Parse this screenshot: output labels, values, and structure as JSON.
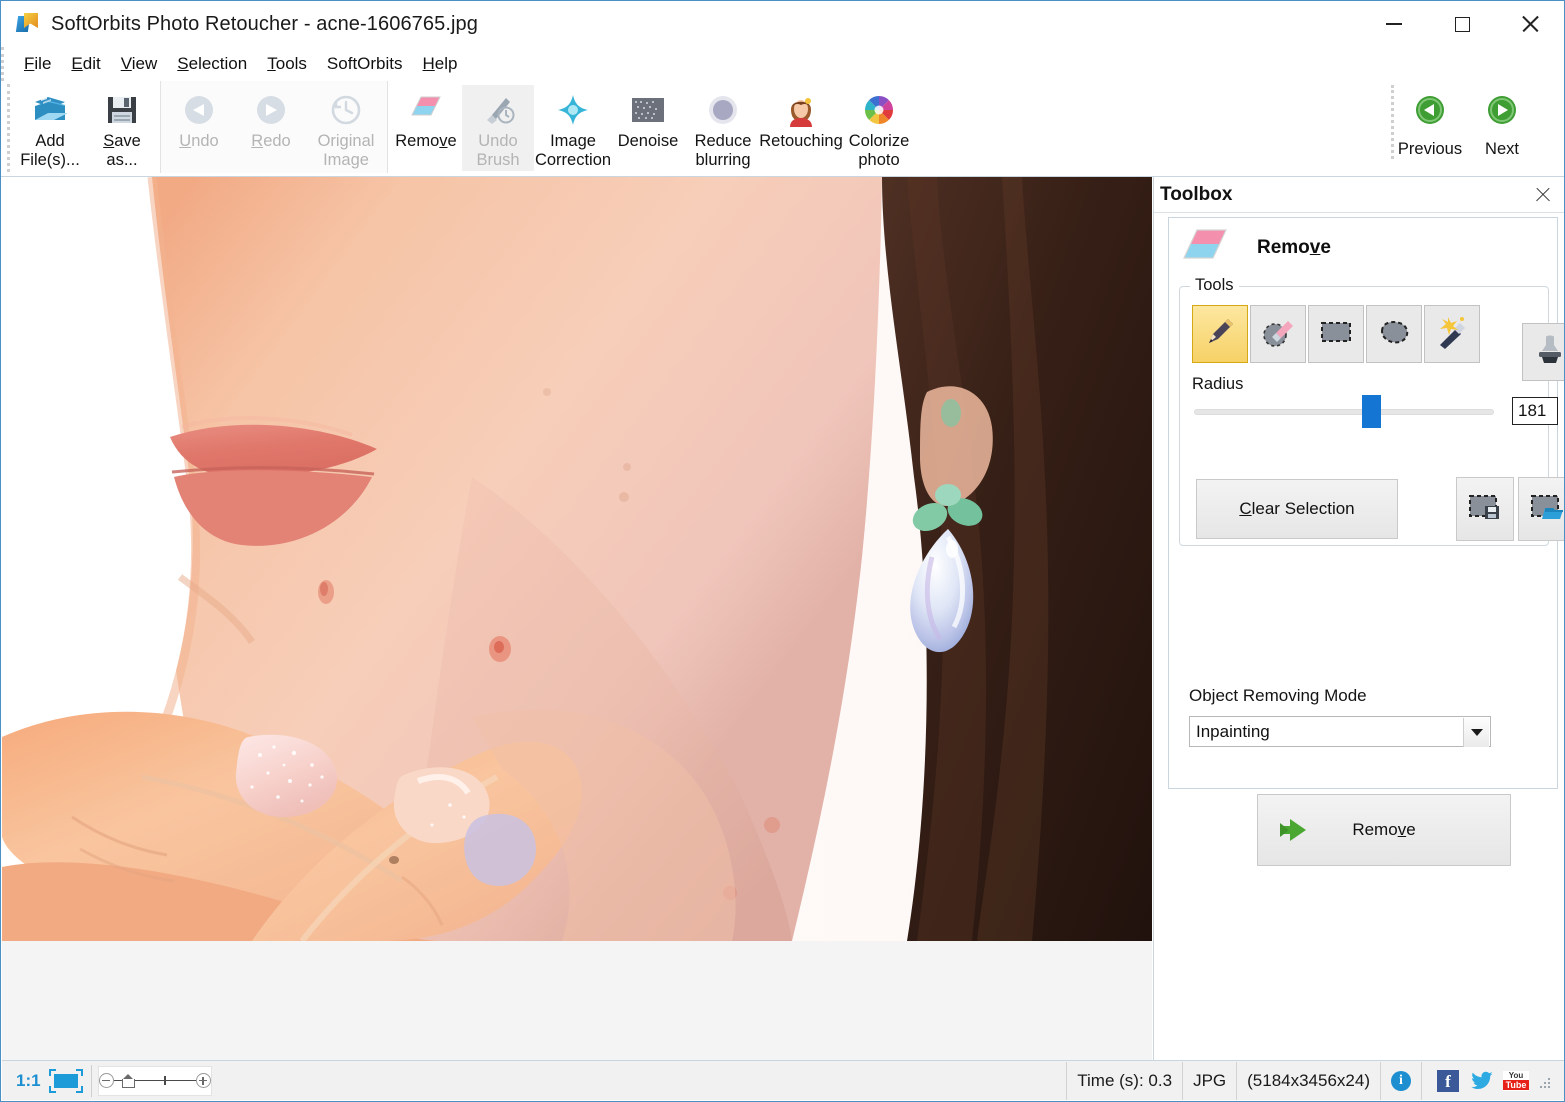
{
  "window": {
    "title": "SoftOrbits Photo Retoucher - acne-1606765.jpg",
    "app_icon": "softorbits-logo-icon",
    "minimize_label": "",
    "maximize_label": "",
    "close_label": ""
  },
  "menubar": {
    "items": [
      {
        "label": "File",
        "accel": "F"
      },
      {
        "label": "Edit",
        "accel": "E"
      },
      {
        "label": "View",
        "accel": "V"
      },
      {
        "label": "Selection",
        "accel": "S"
      },
      {
        "label": "Tools",
        "accel": "T"
      },
      {
        "label": "SoftOrbits",
        "accel": ""
      },
      {
        "label": "Help",
        "accel": "H"
      }
    ]
  },
  "ribbon": {
    "buttons": [
      {
        "label": "Add\nFile(s)...",
        "icon": "add-files-icon",
        "disabled": false,
        "active": false
      },
      {
        "label": "Save\nas...",
        "icon": "save-floppy-icon",
        "disabled": false,
        "active": false
      },
      {
        "label": "Undo",
        "icon": "undo-arrow-icon",
        "disabled": true,
        "active": false
      },
      {
        "label": "Redo",
        "icon": "redo-arrow-icon",
        "disabled": true,
        "active": false
      },
      {
        "label": "Original\nImage",
        "icon": "clock-history-icon",
        "disabled": true,
        "active": false
      },
      {
        "label": "Remove",
        "icon": "eraser-icon",
        "disabled": false,
        "active": false
      },
      {
        "label": "Undo\nBrush",
        "icon": "undo-brush-icon",
        "disabled": true,
        "active": true
      },
      {
        "label": "Image\nCorrection",
        "icon": "sparkle-star-icon",
        "disabled": false,
        "active": false
      },
      {
        "label": "Denoise",
        "icon": "noise-grid-icon",
        "disabled": false,
        "active": false
      },
      {
        "label": "Reduce\nblurring",
        "icon": "blur-circle-icon",
        "disabled": false,
        "active": false
      },
      {
        "label": "Retouching",
        "icon": "portrait-woman-icon",
        "disabled": false,
        "active": false
      },
      {
        "label": "Colorize\nphoto",
        "icon": "color-wheel-icon",
        "disabled": false,
        "active": false
      }
    ],
    "nav": [
      {
        "label": "Previous",
        "icon": "green-left-arrow-icon"
      },
      {
        "label": "Next",
        "icon": "green-right-arrow-icon"
      }
    ],
    "expander_icon": "chevron-down-icon"
  },
  "toolbox": {
    "panel_title": "Toolbox",
    "close_icon": "close-icon",
    "section": {
      "icon": "eraser-icon",
      "title": "Remove",
      "title_accel": "v"
    },
    "tools_group": {
      "legend": "Tools",
      "items": [
        {
          "name": "brush-pencil-tool",
          "icon": "pencil-icon",
          "selected": true
        },
        {
          "name": "eraser-tool",
          "icon": "eraser-selection-icon",
          "selected": false
        },
        {
          "name": "rectangle-select-tool",
          "icon": "rectangle-marquee-icon",
          "selected": false
        },
        {
          "name": "lasso-select-tool",
          "icon": "lasso-icon",
          "selected": false
        },
        {
          "name": "magic-wand-tool",
          "icon": "magic-wand-icon",
          "selected": false
        },
        {
          "name": "clone-stamp-tool",
          "icon": "stamp-icon",
          "selected": false
        }
      ]
    },
    "radius": {
      "label": "Radius",
      "value": "181",
      "slider_percent": 60
    },
    "clear_selection": {
      "label": "Clear Selection",
      "accel": "C"
    },
    "selection_io": [
      {
        "name": "save-selection-button",
        "icon": "save-selection-icon"
      },
      {
        "name": "load-selection-button",
        "icon": "load-selection-icon"
      }
    ],
    "object_removing_mode": {
      "label": "Object Removing Mode",
      "value": "Inpainting",
      "options": [
        "Inpainting"
      ],
      "arrow_icon": "chevron-down-icon"
    },
    "remove_action": {
      "label": "Remove",
      "accel": "v",
      "icon": "green-double-arrow-icon"
    }
  },
  "canvas": {
    "photo_description": "close-up photo of a woman's lower face, chin and cheek with acne spots, her hand with glittery manicured fingernails touching her chin, dangling crystal earring and dark brown hair on the right",
    "background_color": "#f4f4f4"
  },
  "statusbar": {
    "zoom_ratio": "1:1",
    "fit_icon": "fit-to-window-icon",
    "zoom_out_icon": "zoom-out-icon",
    "zoom_home_icon": "actual-size-icon",
    "zoom_in_icon": "zoom-in-icon",
    "time_label": "Time (s): 0.3",
    "format": "JPG",
    "dimensions": "(5184x3456x24)",
    "info_icon": "info-icon",
    "facebook_icon": "facebook-icon",
    "twitter_icon": "twitter-icon",
    "youtube_icon": "youtube-icon",
    "youtube_line1": "You",
    "youtube_line2": "Tube",
    "resize_grip_icon": "resize-grip-icon"
  },
  "colors": {
    "accent_blue": "#1476d2",
    "selected_tool_yellow": "#f6d166",
    "window_border": "#4a90c4",
    "green_nav": "#3a9e34",
    "link_blue": "#1d8fd1"
  }
}
